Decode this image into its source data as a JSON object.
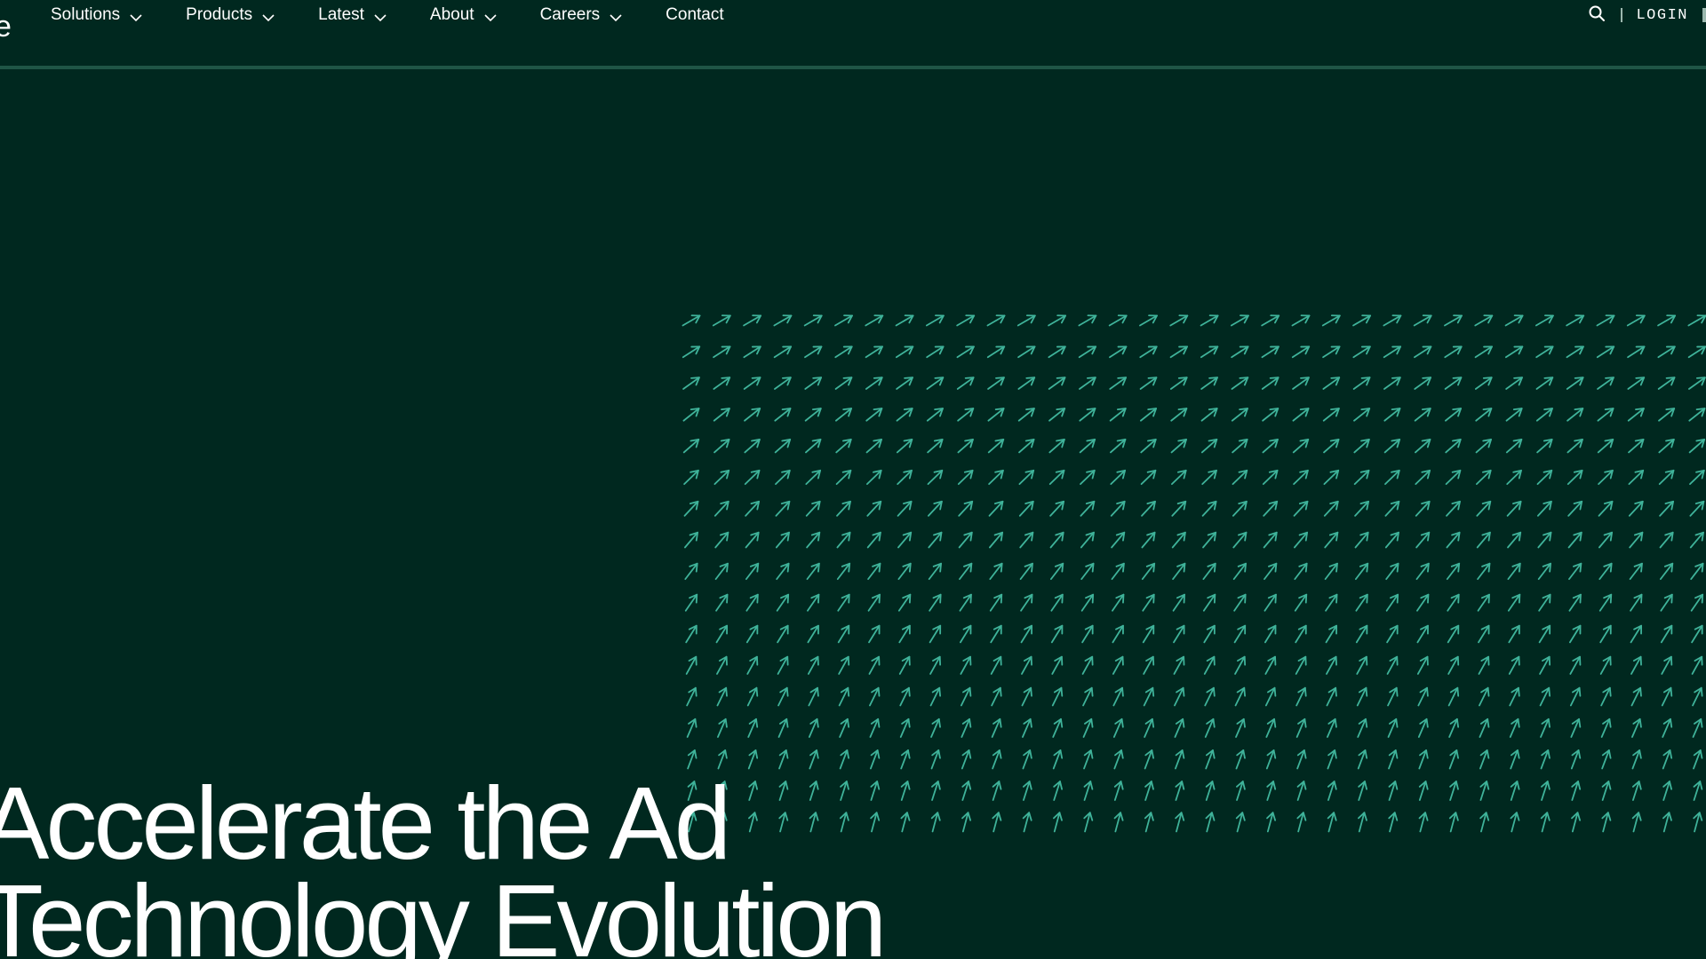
{
  "header": {
    "logo_fragment": "e",
    "nav": [
      {
        "label": "Solutions",
        "has_dropdown": true
      },
      {
        "label": "Products",
        "has_dropdown": true
      },
      {
        "label": "Latest",
        "has_dropdown": true
      },
      {
        "label": "About",
        "has_dropdown": true
      },
      {
        "label": "Careers",
        "has_dropdown": true
      },
      {
        "label": "Contact",
        "has_dropdown": false
      }
    ],
    "search_icon": "search-icon",
    "login_label": "LOGIN"
  },
  "hero": {
    "title_line1": "Accelerate the Ad",
    "title_line2": "Technology Evolution"
  },
  "pattern": {
    "icon": "arrow-up-right-icon",
    "rows": 17,
    "columns": 34,
    "color": "#3fb39a"
  },
  "colors": {
    "background": "#00281f",
    "divider": "#1f5546",
    "text": "#ffffff",
    "accent": "#3fb39a"
  }
}
